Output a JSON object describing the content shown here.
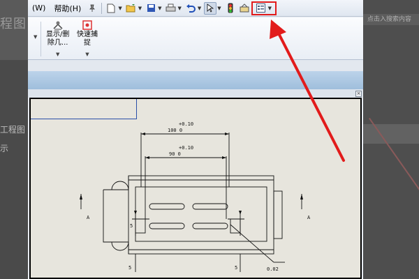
{
  "menubar": {
    "partial_menu": "(W)",
    "help_menu": "帮助(H)"
  },
  "ribbon": {
    "show_hide_label": "显示/删\n除几...",
    "quick_snap_label": "快速捕\n捉"
  },
  "background": {
    "title_fragment": "程图",
    "left_text_1": "工程图",
    "left_text_2": "示",
    "right_search_text": "点击入搜索内容"
  },
  "drawing": {
    "dim_top_tolerance": "+0.10",
    "dim_top_value": "100  0",
    "dim_inner_tolerance": "+0.10",
    "dim_inner_value": "90  0",
    "section_label_left": "A",
    "section_label_right": "A",
    "small_dim_1": "5",
    "small_dim_2": "5",
    "small_dim_3": "5",
    "leader_label": "0.02"
  },
  "annotation": {
    "highlight_color": "#e21b1b",
    "arrow_color": "#e21b1b"
  }
}
